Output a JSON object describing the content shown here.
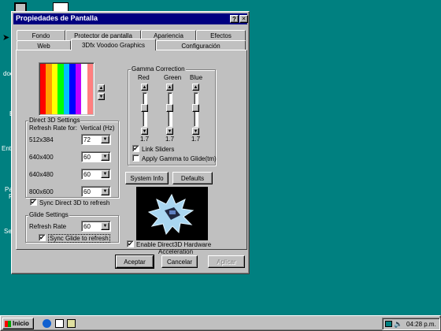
{
  "window": {
    "title": "Propiedades de Pantalla",
    "help_label": "?",
    "close_label": "✕"
  },
  "tabs_back": [
    "Fondo",
    "Protector de pantalla",
    "Apariencia",
    "Efectos"
  ],
  "tabs_front": [
    "Web",
    "3Dfx Voodoo Graphics",
    "Configuración"
  ],
  "d3d": {
    "group_title": "Direct 3D Settings",
    "refresh_label": "Refresh Rate for:",
    "vertical_label": "Vertical (Hz)",
    "rows": [
      {
        "res": "512x384",
        "value": "72"
      },
      {
        "res": "640x400",
        "value": "60"
      },
      {
        "res": "640x480",
        "value": "60"
      },
      {
        "res": "800x600",
        "value": "60"
      }
    ],
    "sync_label": "Sync Direct 3D to refresh",
    "sync_checked": "✔"
  },
  "glide": {
    "group_title": "Glide Settings",
    "refresh_label": "Refresh Rate",
    "refresh_value": "60",
    "sync_label": "Sync Glide to refresh",
    "sync_checked": "✔"
  },
  "gamma": {
    "group_title": "Gamma Correction",
    "channels": [
      {
        "name": "Red",
        "value": "1.7"
      },
      {
        "name": "Green",
        "value": "1.7"
      },
      {
        "name": "Blue",
        "value": "1.7"
      }
    ],
    "link_label": "Link Sliders",
    "link_checked": "✔",
    "apply_label": "Apply Gamma to Glide(tm)",
    "apply_checked": ""
  },
  "buttons": {
    "system_info": "System Info",
    "defaults": "Defaults",
    "accept": "Aceptar",
    "cancel": "Cancelar",
    "apply": "Aplicar"
  },
  "hw_accel": {
    "label_line1": "Enable Direct3D Hardware",
    "label_line2": "Acceleration",
    "checked": "✔"
  },
  "desktop": {
    "labels": [
      "doc",
      "E",
      "Ento",
      "Pa",
      "R",
      "Se"
    ]
  },
  "taskbar": {
    "start_label": "Inicio",
    "clock": "04:28 p.m."
  },
  "colors": {
    "title_bar": "#000080",
    "desktop": "#008080",
    "face": "#c0c0c0"
  },
  "color_bars": [
    "#ff0000",
    "#ffa000",
    "#ffff00",
    "#00ff00",
    "#00c0ff",
    "#0000ff",
    "#c000ff",
    "#ffffff",
    "#ff8080"
  ]
}
